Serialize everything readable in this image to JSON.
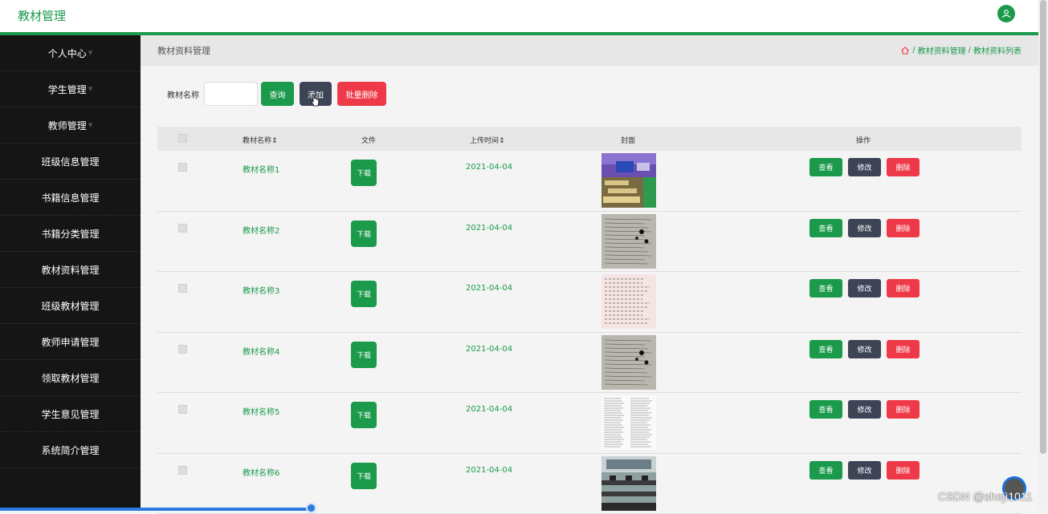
{
  "header": {
    "title": "教材管理",
    "avatar_icon": "user-icon"
  },
  "sidebar": {
    "items": [
      {
        "label": "个人中心",
        "arrow": "▼"
      },
      {
        "label": "学生管理",
        "arrow": "▼"
      },
      {
        "label": "教师管理",
        "arrow": "▼"
      },
      {
        "label": "班级信息管理"
      },
      {
        "label": "书籍信息管理"
      },
      {
        "label": "书籍分类管理"
      },
      {
        "label": "教材资料管理"
      },
      {
        "label": "班级教材管理"
      },
      {
        "label": "教师申请管理"
      },
      {
        "label": "领取教材管理"
      },
      {
        "label": "学生意见管理"
      },
      {
        "label": "系统简介管理"
      }
    ]
  },
  "page": {
    "title": "教材资料管理",
    "breadcrumb": {
      "sep1": "/",
      "item1": "教材资料管理",
      "sep2": "/",
      "item2": "教材资料列表"
    }
  },
  "search": {
    "label": "教材名称",
    "value": "",
    "query_label": "查询",
    "add_label": "添加",
    "batch_delete_label": "批量删除"
  },
  "table": {
    "headers": {
      "name": "教材名称",
      "file": "文件",
      "upload_time": "上传时间",
      "cover": "封面",
      "actions": "操作"
    },
    "sort_glyph": "⇕",
    "download_label": "下载",
    "view_label": "查看",
    "edit_label": "修改",
    "delete_label": "删除",
    "rows": [
      {
        "name": "教材名称1",
        "date": "2021-04-04",
        "cover": "classroom"
      },
      {
        "name": "教材名称2",
        "date": "2021-04-04",
        "cover": "handwritten"
      },
      {
        "name": "教材名称3",
        "date": "2021-04-04",
        "cover": "printed-pink"
      },
      {
        "name": "教材名称4",
        "date": "2021-04-04",
        "cover": "handwritten"
      },
      {
        "name": "教材名称5",
        "date": "2021-04-04",
        "cover": "text-doc"
      },
      {
        "name": "教材名称6",
        "date": "2021-04-04",
        "cover": "lab"
      }
    ]
  },
  "watermark": "CSDN @shejì1011",
  "colors": {
    "accent": "#1a9a4a",
    "dark": "#3d4456",
    "danger": "#ee3a48",
    "sidebar": "#151515"
  }
}
